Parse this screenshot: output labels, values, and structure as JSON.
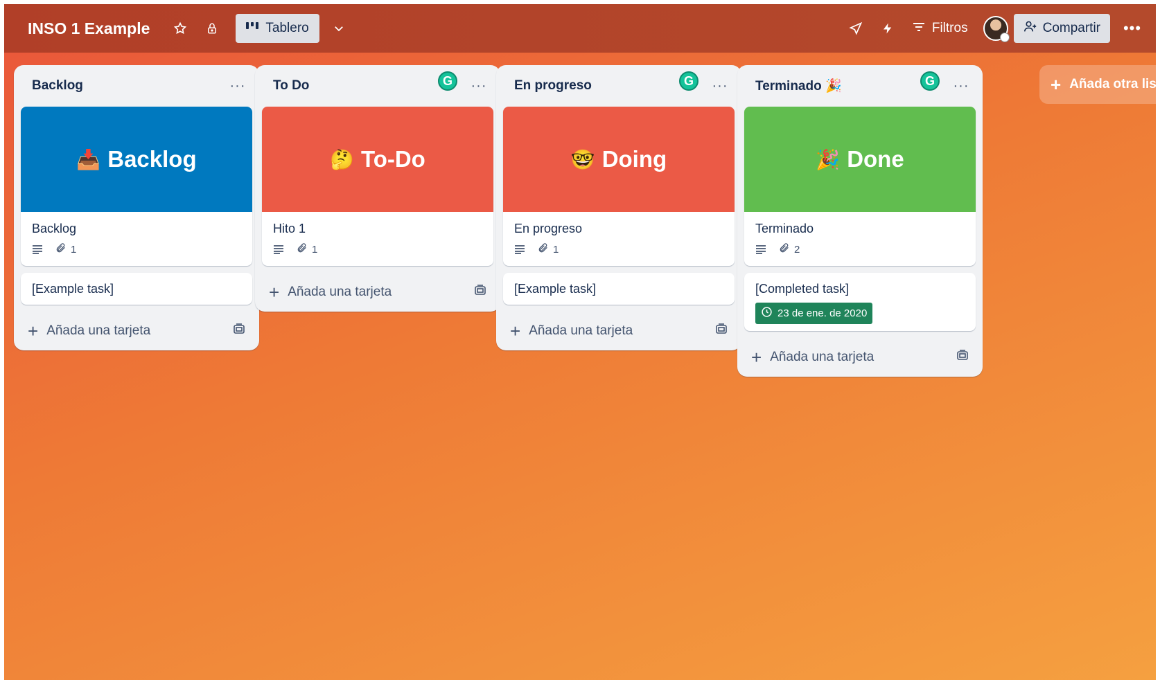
{
  "header": {
    "title": "INSO 1 Example",
    "view_label": "Tablero",
    "filters_label": "Filtros",
    "share_label": "Compartir"
  },
  "lists": [
    {
      "title": "Backlog",
      "cover": {
        "emoji": "📥",
        "text": "Backlog",
        "color": "#0079bf"
      },
      "cover_card_title": "Backlog",
      "attachments": "1",
      "extra_card": {
        "title": "[Example task]"
      },
      "add_label": "Añada una tarjeta"
    },
    {
      "title": "To Do",
      "cover": {
        "emoji": "🤔",
        "text": "To-Do",
        "color": "#eb5a46"
      },
      "cover_card_title": "Hito 1",
      "attachments": "1",
      "add_label": "Añada una tarjeta"
    },
    {
      "title": "En progreso",
      "cover": {
        "emoji": "🤓",
        "text": "Doing",
        "color": "#eb5a46"
      },
      "cover_card_title": "En progreso",
      "attachments": "1",
      "extra_card": {
        "title": "[Example task]"
      },
      "add_label": "Añada una tarjeta"
    },
    {
      "title": "Terminado 🎉",
      "cover": {
        "emoji": "🎉",
        "text": "Done",
        "color": "#61bd4f"
      },
      "cover_card_title": "Terminado",
      "attachments": "2",
      "extra_card": {
        "title": "[Completed task]",
        "due_date": "23 de ene. de 2020"
      },
      "add_label": "Añada una tarjeta"
    }
  ],
  "add_list_label": "Añada otra lista",
  "grammarly_letter": "G",
  "icons": [
    "star-icon",
    "lock-icon",
    "board-icon",
    "chevron-down-icon",
    "power-up-icon",
    "automation-icon",
    "filter-icon",
    "add-user-icon",
    "more-icon",
    "description-icon",
    "attachment-icon",
    "clock-icon",
    "plus-icon",
    "template-icon"
  ]
}
